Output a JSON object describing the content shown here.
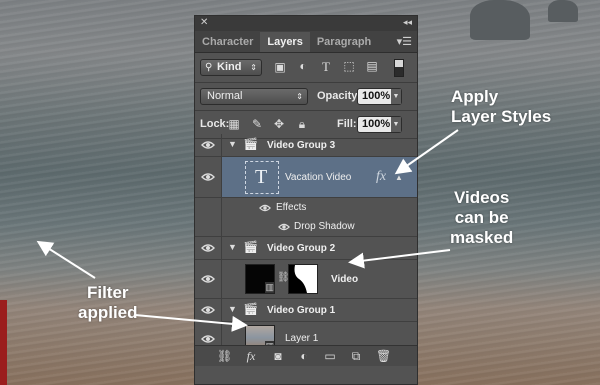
{
  "panel": {
    "close_glyph": "✕",
    "collapse_glyph": "◂◂",
    "tabs": [
      {
        "label": "Character"
      },
      {
        "label": "Layers"
      },
      {
        "label": "Paragraph"
      }
    ],
    "filter": {
      "kind_label": "Kind"
    },
    "blend_mode": "Normal",
    "opacity_label": "Opacity:",
    "opacity_value": "100%",
    "lock_label": "Lock:",
    "fill_label": "Fill:",
    "fill_value": "100%",
    "layers": {
      "video_group_3": "Video Group 3",
      "vacation_video": "Vacation Video",
      "fx_badge": "fx",
      "effects": "Effects",
      "drop_shadow": "Drop Shadow",
      "video_group_2": "Video Group 2",
      "video": "Video",
      "video_group_1": "Video Group 1",
      "layer_1": "Layer 1"
    },
    "bottom_fx": "fx"
  },
  "callouts": {
    "apply_layer_styles": "Apply\nLayer Styles",
    "videos_masked": "Videos\ncan be\nmasked",
    "filter_applied": "Filter\napplied"
  },
  "colors": {
    "selected_layer": "#5d7087",
    "panel_bg": "#535353"
  }
}
